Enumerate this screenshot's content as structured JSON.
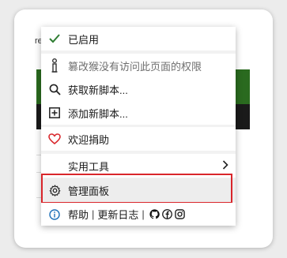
{
  "background": {
    "partial_text": "re"
  },
  "menu": {
    "items": [
      {
        "label": "已启用",
        "icon": "checkmark-icon"
      },
      {
        "label": "篡改猴没有访问此页面的权限",
        "icon": "info-i-icon"
      },
      {
        "label": "获取新脚本...",
        "icon": "search-icon"
      },
      {
        "label": "添加新脚本...",
        "icon": "plus-square-icon"
      },
      {
        "label": "欢迎捐助",
        "icon": "heart-icon"
      },
      {
        "label": "实用工具",
        "icon": ""
      },
      {
        "label": "管理面板",
        "icon": "gear-icon"
      }
    ],
    "footer": {
      "help": "帮助",
      "changelog": "更新日志",
      "separator": "|"
    }
  },
  "colors": {
    "highlight_border": "#d9262b",
    "check": "#2e7d32",
    "heart": "#d9262b",
    "info": "#1c6fb8"
  }
}
